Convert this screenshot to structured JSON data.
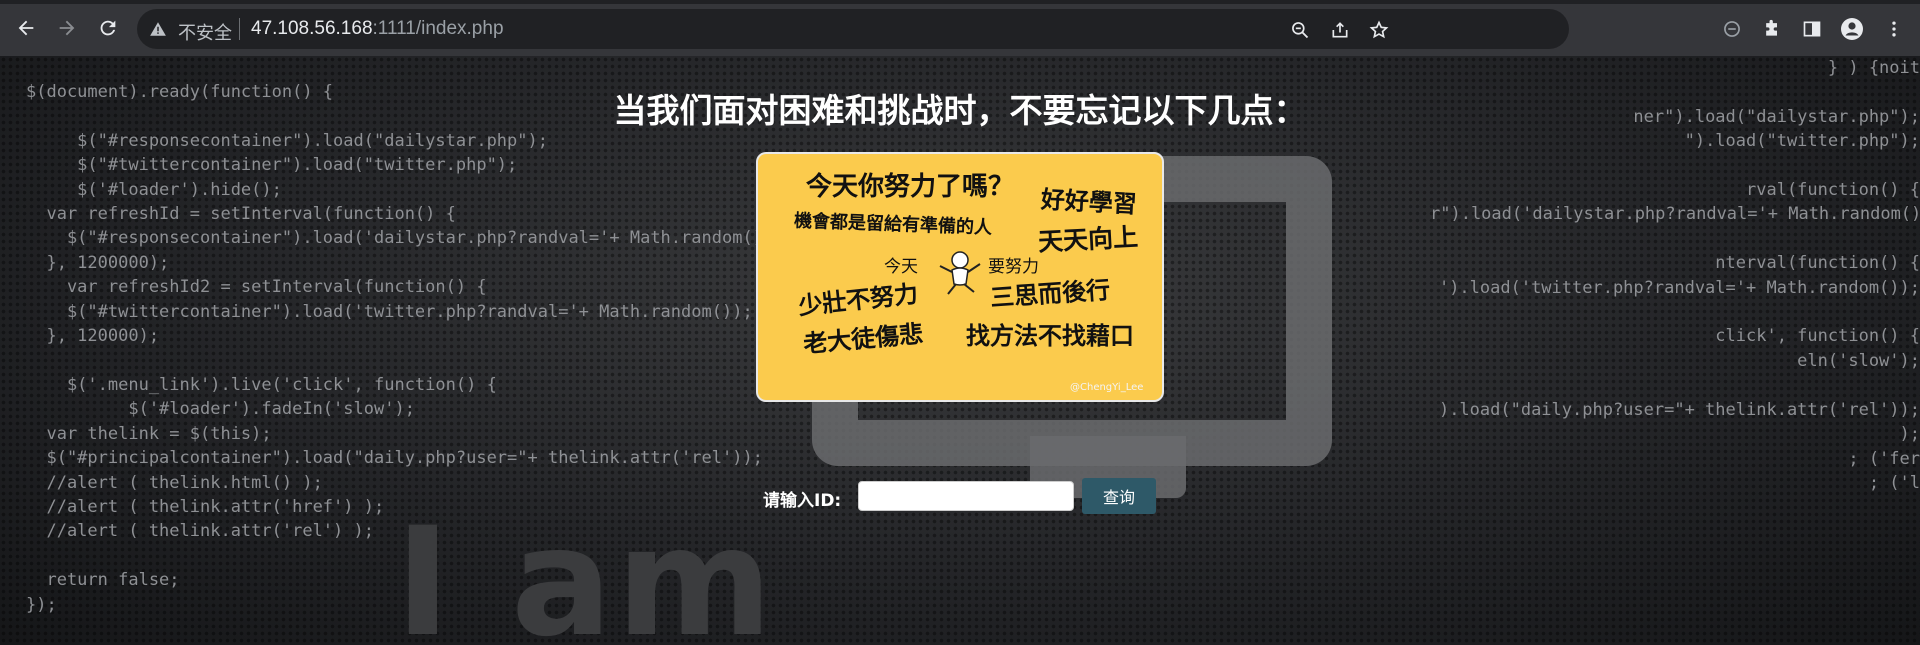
{
  "browser": {
    "insecure_label": "不安全",
    "url_host": "47.108.56.168",
    "url_rest": ":1111/index.php"
  },
  "page": {
    "heading": "当我们面对困难和挑战时，不要忘记以下几点：",
    "background_watermark": "I am",
    "code_left": [
      "$(document).ready(function() {",
      "",
      "     $(\"#responsecontainer\").load(\"dailystar.php\");",
      "     $(\"#twittercontainer\").load(\"twitter.php\");",
      "     $('#loader').hide();",
      "  var refreshId = setInterval(function() {",
      "    $(\"#responsecontainer\").load('dailystar.php?randval='+ Math.random());",
      "  }, 1200000);",
      "    var refreshId2 = setInterval(function() {",
      "    $(\"#twittercontainer\").load('twitter.php?randval='+ Math.random());",
      "  }, 120000);",
      "",
      "    $('.menu_link').live('click', function() {",
      "          $('#loader').fadeIn('slow');",
      "  var thelink = $(this);",
      "  $(\"#principalcontainer\").load(\"daily.php?user=\"+ thelink.attr('rel'));",
      "  //alert ( thelink.html() );",
      "  //alert ( thelink.attr('href') );",
      "  //alert ( thelink.attr('rel') );",
      "",
      "  return false;",
      "});"
    ],
    "code_right": [
      "} ) {noit",
      "",
      "ner\").load(\"dailystar.php\");",
      "\").load(\"twitter.php\");",
      "",
      "rval(function() {",
      "r\").load('dailystar.php?randval='+ Math.random());",
      "",
      "nterval(function() {",
      "').load('twitter.php?randval='+ Math.random());",
      "",
      "click', function() {",
      "eln('slow');",
      "",
      ").load(\"daily.php?user=\"+ thelink.attr('rel'));",
      ");",
      "; ('fer",
      "; ('l"
    ]
  },
  "poster": {
    "line1": "今天你努力了嗎？",
    "line2": "好好學習",
    "line3": "機會都是留給有準備的人",
    "line4": "天天向上",
    "line5a": "今天",
    "line5b": "要努力",
    "line6": "少壯不努力",
    "line7": "三思而後行",
    "line8": "老大徒傷悲",
    "line9": "找方法不找藉口",
    "watermark": "@ChengYi_Lee"
  },
  "form": {
    "label": "请输入ID:",
    "input_value": "",
    "button_label": "查询"
  },
  "icons": {
    "back": "back-arrow-icon",
    "forward": "forward-arrow-icon",
    "reload": "reload-icon",
    "warning": "warning-triangle-icon",
    "zoom": "zoom-out-icon",
    "share": "share-icon",
    "bookmark": "star-icon",
    "extensions_block": "circle-minus-icon",
    "extensions": "puzzle-icon",
    "sidepanel": "side-panel-icon",
    "profile": "profile-avatar-icon",
    "menu": "kebab-menu-icon"
  }
}
